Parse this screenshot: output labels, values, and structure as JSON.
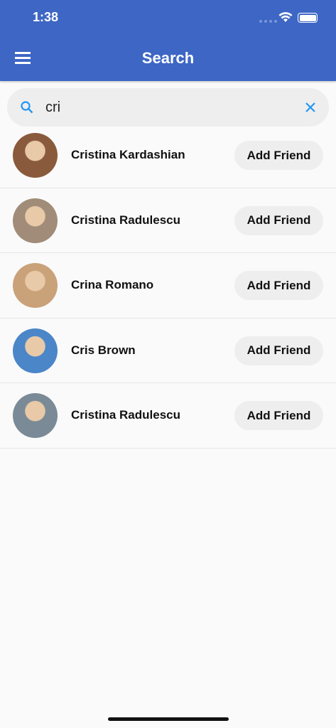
{
  "status_bar": {
    "time": "1:38"
  },
  "header": {
    "title": "Search"
  },
  "search": {
    "value": "cri"
  },
  "results": [
    {
      "name": "Cristina Kardashian",
      "action": "Add Friend",
      "avatar_color": "#8a5a3c"
    },
    {
      "name": "Cristina Radulescu",
      "action": "Add Friend",
      "avatar_color": "#a08c78"
    },
    {
      "name": "Crina Romano",
      "action": "Add Friend",
      "avatar_color": "#c9a27a"
    },
    {
      "name": "Cris Brown",
      "action": "Add Friend",
      "avatar_color": "#4a86c8"
    },
    {
      "name": "Cristina Radulescu",
      "action": "Add Friend",
      "avatar_color": "#7a8a96"
    }
  ],
  "colors": {
    "header": "#3d66c5",
    "accent": "#2196f3"
  }
}
